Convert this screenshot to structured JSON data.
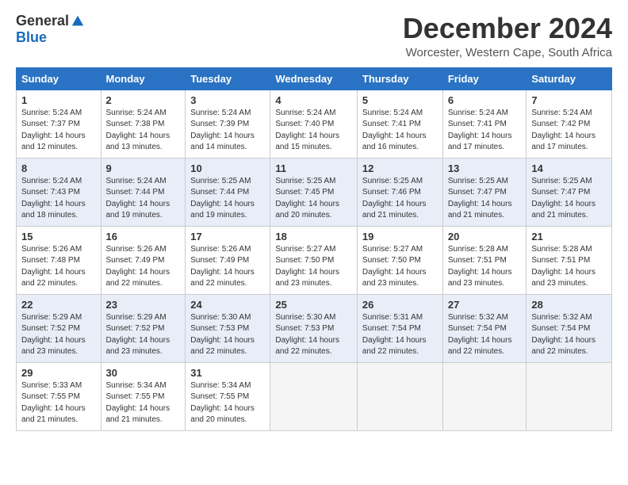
{
  "header": {
    "logo_general": "General",
    "logo_blue": "Blue",
    "month": "December 2024",
    "location": "Worcester, Western Cape, South Africa"
  },
  "calendar": {
    "days_of_week": [
      "Sunday",
      "Monday",
      "Tuesday",
      "Wednesday",
      "Thursday",
      "Friday",
      "Saturday"
    ],
    "weeks": [
      [
        null,
        {
          "day": "2",
          "sunrise": "5:24 AM",
          "sunset": "7:38 PM",
          "daylight": "14 hours and 13 minutes."
        },
        {
          "day": "3",
          "sunrise": "5:24 AM",
          "sunset": "7:39 PM",
          "daylight": "14 hours and 14 minutes."
        },
        {
          "day": "4",
          "sunrise": "5:24 AM",
          "sunset": "7:40 PM",
          "daylight": "14 hours and 15 minutes."
        },
        {
          "day": "5",
          "sunrise": "5:24 AM",
          "sunset": "7:41 PM",
          "daylight": "14 hours and 16 minutes."
        },
        {
          "day": "6",
          "sunrise": "5:24 AM",
          "sunset": "7:41 PM",
          "daylight": "14 hours and 17 minutes."
        },
        {
          "day": "7",
          "sunrise": "5:24 AM",
          "sunset": "7:42 PM",
          "daylight": "14 hours and 17 minutes."
        }
      ],
      [
        {
          "day": "1",
          "sunrise": "5:24 AM",
          "sunset": "7:37 PM",
          "daylight": "14 hours and 12 minutes."
        },
        {
          "day": "8",
          "sunrise": "5:24 AM",
          "sunset": "7:43 PM",
          "daylight": "14 hours and 18 minutes."
        },
        {
          "day": "9",
          "sunrise": "5:24 AM",
          "sunset": "7:44 PM",
          "daylight": "14 hours and 19 minutes."
        },
        {
          "day": "10",
          "sunrise": "5:25 AM",
          "sunset": "7:44 PM",
          "daylight": "14 hours and 19 minutes."
        },
        {
          "day": "11",
          "sunrise": "5:25 AM",
          "sunset": "7:45 PM",
          "daylight": "14 hours and 20 minutes."
        },
        {
          "day": "12",
          "sunrise": "5:25 AM",
          "sunset": "7:46 PM",
          "daylight": "14 hours and 21 minutes."
        },
        {
          "day": "13",
          "sunrise": "5:25 AM",
          "sunset": "7:47 PM",
          "daylight": "14 hours and 21 minutes."
        }
      ],
      [
        {
          "day": "14",
          "sunrise": "5:25 AM",
          "sunset": "7:47 PM",
          "daylight": "14 hours and 21 minutes."
        },
        {
          "day": "15",
          "sunrise": "5:26 AM",
          "sunset": "7:48 PM",
          "daylight": "14 hours and 22 minutes."
        },
        {
          "day": "16",
          "sunrise": "5:26 AM",
          "sunset": "7:49 PM",
          "daylight": "14 hours and 22 minutes."
        },
        {
          "day": "17",
          "sunrise": "5:26 AM",
          "sunset": "7:49 PM",
          "daylight": "14 hours and 22 minutes."
        },
        {
          "day": "18",
          "sunrise": "5:27 AM",
          "sunset": "7:50 PM",
          "daylight": "14 hours and 23 minutes."
        },
        {
          "day": "19",
          "sunrise": "5:27 AM",
          "sunset": "7:50 PM",
          "daylight": "14 hours and 23 minutes."
        },
        {
          "day": "20",
          "sunrise": "5:28 AM",
          "sunset": "7:51 PM",
          "daylight": "14 hours and 23 minutes."
        }
      ],
      [
        {
          "day": "21",
          "sunrise": "5:28 AM",
          "sunset": "7:51 PM",
          "daylight": "14 hours and 23 minutes."
        },
        {
          "day": "22",
          "sunrise": "5:29 AM",
          "sunset": "7:52 PM",
          "daylight": "14 hours and 23 minutes."
        },
        {
          "day": "23",
          "sunrise": "5:29 AM",
          "sunset": "7:52 PM",
          "daylight": "14 hours and 23 minutes."
        },
        {
          "day": "24",
          "sunrise": "5:30 AM",
          "sunset": "7:53 PM",
          "daylight": "14 hours and 22 minutes."
        },
        {
          "day": "25",
          "sunrise": "5:30 AM",
          "sunset": "7:53 PM",
          "daylight": "14 hours and 22 minutes."
        },
        {
          "day": "26",
          "sunrise": "5:31 AM",
          "sunset": "7:54 PM",
          "daylight": "14 hours and 22 minutes."
        },
        {
          "day": "27",
          "sunrise": "5:32 AM",
          "sunset": "7:54 PM",
          "daylight": "14 hours and 22 minutes."
        }
      ],
      [
        {
          "day": "28",
          "sunrise": "5:32 AM",
          "sunset": "7:54 PM",
          "daylight": "14 hours and 22 minutes."
        },
        {
          "day": "29",
          "sunrise": "5:33 AM",
          "sunset": "7:55 PM",
          "daylight": "14 hours and 21 minutes."
        },
        {
          "day": "30",
          "sunrise": "5:34 AM",
          "sunset": "7:55 PM",
          "daylight": "14 hours and 21 minutes."
        },
        {
          "day": "31",
          "sunrise": "5:34 AM",
          "sunset": "7:55 PM",
          "daylight": "14 hours and 20 minutes."
        },
        null,
        null,
        null
      ]
    ]
  }
}
